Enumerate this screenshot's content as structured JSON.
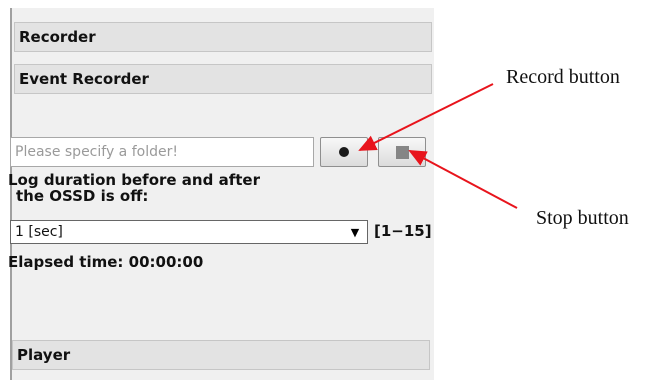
{
  "panel": {
    "recorder_header": "Recorder",
    "event_recorder_header": "Event Recorder",
    "folder_placeholder": "Please specify a folder!",
    "record_icon": "record-dot-icon",
    "stop_icon": "stop-square-icon",
    "log_label_line1": "Log duration before and after",
    "log_label_line2": "the OSSD is off:",
    "duration_value": "1 [sec]",
    "duration_range": "[1−15]",
    "elapsed_label": "Elapsed time:",
    "elapsed_value": "00:00:00",
    "player_header": "Player"
  },
  "annotations": {
    "record_label": "Record button",
    "stop_label": "Stop button",
    "arrow_color": "#e8141c"
  }
}
